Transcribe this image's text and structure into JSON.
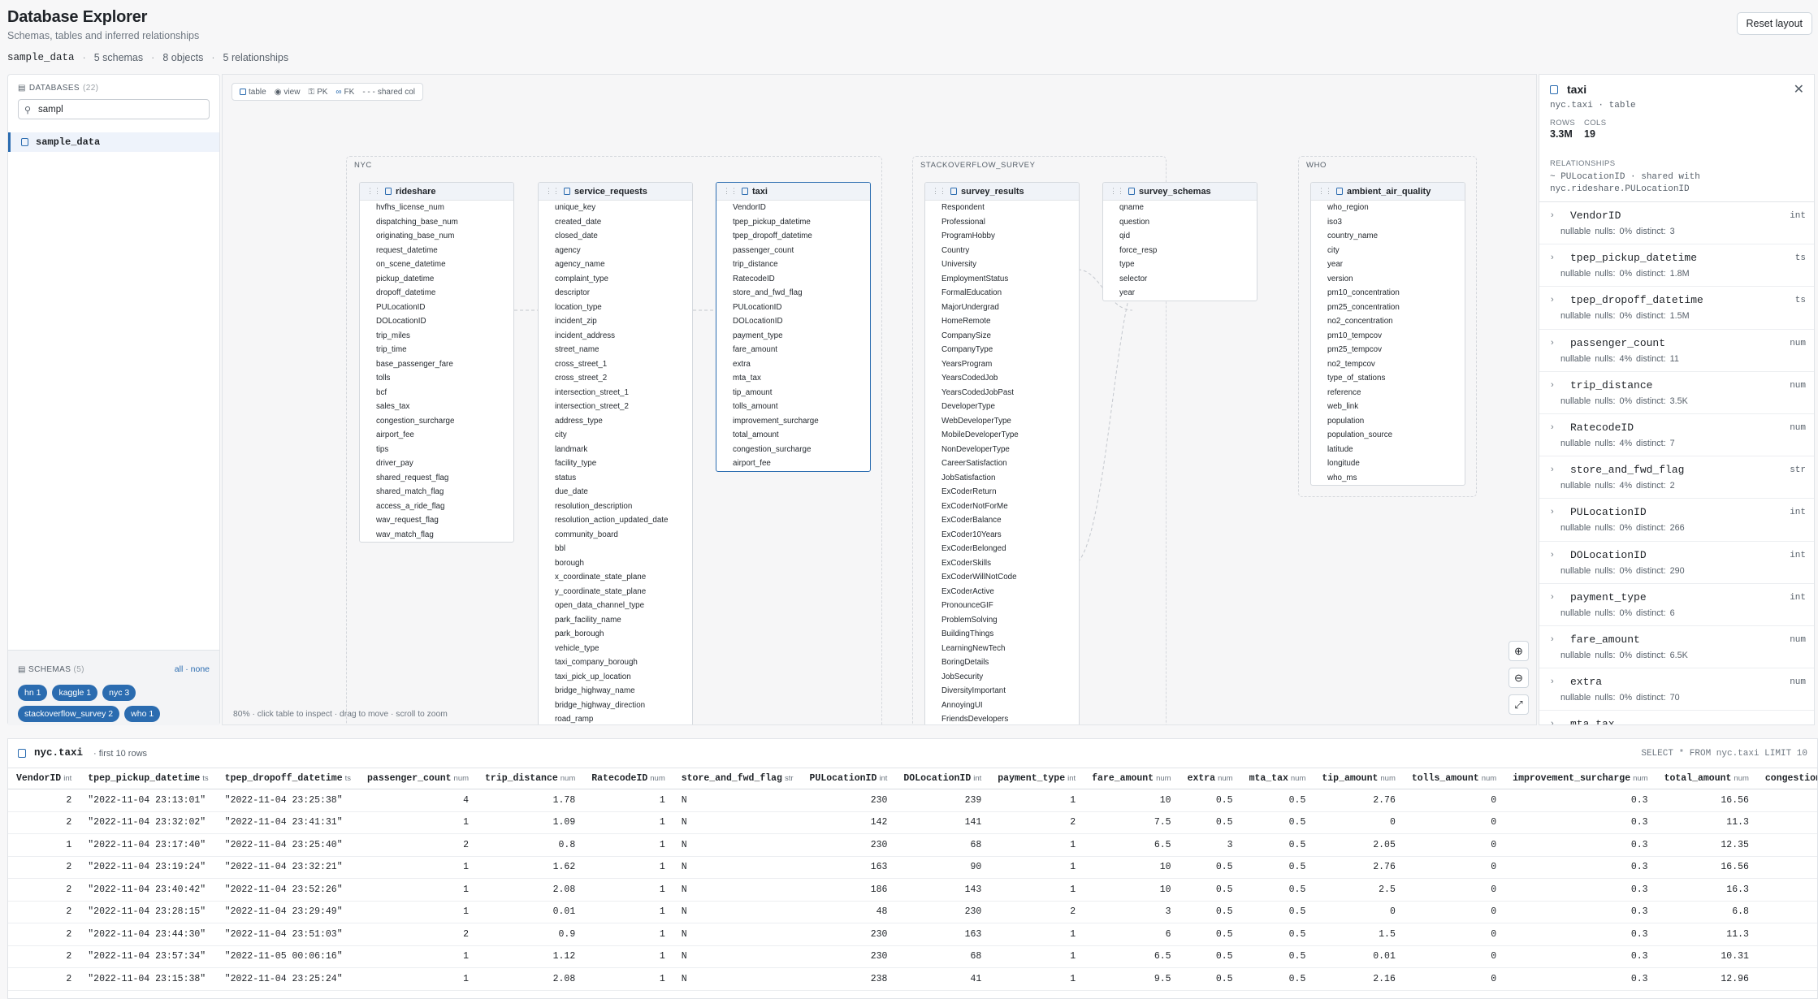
{
  "header": {
    "title": "Database Explorer",
    "subtitle": "Schemas, tables and inferred relationships",
    "reset": "Reset layout"
  },
  "crumbs": {
    "db": "sample_data",
    "schemas": "5 schemas",
    "objects": "8 objects",
    "relationships": "5 relationships"
  },
  "sidebar": {
    "title": "DATABASES",
    "count": "(22)",
    "search_value": "sampl",
    "db_item": "sample_data",
    "schemas_title": "SCHEMAS",
    "schemas_count": "(5)",
    "all": "all",
    "none": "none",
    "chips": [
      "hn 1",
      "kaggle 1",
      "nyc 3",
      "stackoverflow_survey 2",
      "who 1"
    ]
  },
  "legend": {
    "table": "table",
    "view": "view",
    "pk": "PK",
    "fk": "FK",
    "shared": "shared col"
  },
  "groups": {
    "nyc": "NYC",
    "so": "STACKOVERFLOW_SURVEY",
    "who": "WHO"
  },
  "tables": {
    "rideshare": {
      "name": "rideshare",
      "cols": [
        "hvfhs_license_num",
        "dispatching_base_num",
        "originating_base_num",
        "request_datetime",
        "on_scene_datetime",
        "pickup_datetime",
        "dropoff_datetime",
        "PULocationID",
        "DOLocationID",
        "trip_miles",
        "trip_time",
        "base_passenger_fare",
        "tolls",
        "bcf",
        "sales_tax",
        "congestion_surcharge",
        "airport_fee",
        "tips",
        "driver_pay",
        "shared_request_flag",
        "shared_match_flag",
        "access_a_ride_flag",
        "wav_request_flag",
        "wav_match_flag"
      ]
    },
    "service_requests": {
      "name": "service_requests",
      "cols": [
        "unique_key",
        "created_date",
        "closed_date",
        "agency",
        "agency_name",
        "complaint_type",
        "descriptor",
        "location_type",
        "incident_zip",
        "incident_address",
        "street_name",
        "cross_street_1",
        "cross_street_2",
        "intersection_street_1",
        "intersection_street_2",
        "address_type",
        "city",
        "landmark",
        "facility_type",
        "status",
        "due_date",
        "resolution_description",
        "resolution_action_updated_date",
        "community_board",
        "bbl",
        "borough",
        "x_coordinate_state_plane",
        "y_coordinate_state_plane",
        "open_data_channel_type",
        "park_facility_name",
        "park_borough",
        "vehicle_type",
        "taxi_company_borough",
        "taxi_pick_up_location",
        "bridge_highway_name",
        "bridge_highway_direction",
        "road_ramp"
      ]
    },
    "taxi": {
      "name": "taxi",
      "cols": [
        "VendorID",
        "tpep_pickup_datetime",
        "tpep_dropoff_datetime",
        "passenger_count",
        "trip_distance",
        "RatecodeID",
        "store_and_fwd_flag",
        "PULocationID",
        "DOLocationID",
        "payment_type",
        "fare_amount",
        "extra",
        "mta_tax",
        "tip_amount",
        "tolls_amount",
        "improvement_surcharge",
        "total_amount",
        "congestion_surcharge",
        "airport_fee"
      ]
    },
    "survey_results": {
      "name": "survey_results",
      "cols": [
        "Respondent",
        "Professional",
        "ProgramHobby",
        "Country",
        "University",
        "EmploymentStatus",
        "FormalEducation",
        "MajorUndergrad",
        "HomeRemote",
        "CompanySize",
        "CompanyType",
        "YearsProgram",
        "YearsCodedJob",
        "YearsCodedJobPast",
        "DeveloperType",
        "WebDeveloperType",
        "MobileDeveloperType",
        "NonDeveloperType",
        "CareerSatisfaction",
        "JobSatisfaction",
        "ExCoderReturn",
        "ExCoderNotForMe",
        "ExCoderBalance",
        "ExCoder10Years",
        "ExCoderBelonged",
        "ExCoderSkills",
        "ExCoderWillNotCode",
        "ExCoderActive",
        "PronounceGIF",
        "ProblemSolving",
        "BuildingThings",
        "LearningNewTech",
        "BoringDetails",
        "JobSecurity",
        "DiversityImportant",
        "AnnoyingUI",
        "FriendsDevelopers"
      ]
    },
    "survey_schemas": {
      "name": "survey_schemas",
      "cols": [
        "qname",
        "question",
        "qid",
        "force_resp",
        "type",
        "selector",
        "year"
      ]
    },
    "ambient_air_quality": {
      "name": "ambient_air_quality",
      "cols": [
        "who_region",
        "iso3",
        "country_name",
        "city",
        "year",
        "version",
        "pm10_concentration",
        "pm25_concentration",
        "no2_concentration",
        "pm10_tempcov",
        "pm25_tempcov",
        "no2_tempcov",
        "type_of_stations",
        "reference",
        "web_link",
        "population",
        "population_source",
        "latitude",
        "longitude",
        "who_ms"
      ]
    }
  },
  "canvas": {
    "hint": "80% · click table to inspect · drag to move · scroll to zoom",
    "zoom_pct": 80
  },
  "inspector": {
    "title": "taxi",
    "subtitle": "nyc.taxi · table",
    "rows_label": "ROWS",
    "rows": "3.3M",
    "cols_label": "COLS",
    "cols": "19",
    "rel_label": "RELATIONSHIPS",
    "rel_text": "~ PULocationID · shared with nyc.rideshare.PULocationID",
    "columns": [
      {
        "name": "VendorID",
        "type": "int",
        "nulls": "nulls: 0%",
        "distinct": "distinct: 3"
      },
      {
        "name": "tpep_pickup_datetime",
        "type": "ts",
        "nulls": "nulls: 0%",
        "distinct": "distinct: 1.8M"
      },
      {
        "name": "tpep_dropoff_datetime",
        "type": "ts",
        "nulls": "nulls: 0%",
        "distinct": "distinct: 1.5M"
      },
      {
        "name": "passenger_count",
        "type": "num",
        "nulls": "nulls: 4%",
        "distinct": "distinct: 11"
      },
      {
        "name": "trip_distance",
        "type": "num",
        "nulls": "nulls: 0%",
        "distinct": "distinct: 3.5K"
      },
      {
        "name": "RatecodeID",
        "type": "num",
        "nulls": "nulls: 4%",
        "distinct": "distinct: 7"
      },
      {
        "name": "store_and_fwd_flag",
        "type": "str",
        "nulls": "nulls: 4%",
        "distinct": "distinct: 2"
      },
      {
        "name": "PULocationID",
        "type": "int",
        "nulls": "nulls: 0%",
        "distinct": "distinct: 266"
      },
      {
        "name": "DOLocationID",
        "type": "int",
        "nulls": "nulls: 0%",
        "distinct": "distinct: 290"
      },
      {
        "name": "payment_type",
        "type": "int",
        "nulls": "nulls: 0%",
        "distinct": "distinct: 6"
      },
      {
        "name": "fare_amount",
        "type": "num",
        "nulls": "nulls: 0%",
        "distinct": "distinct: 6.5K"
      },
      {
        "name": "extra",
        "type": "num",
        "nulls": "nulls: 0%",
        "distinct": "distinct: 70"
      },
      {
        "name": "mta_tax",
        "type": "",
        "nulls": "",
        "distinct": ""
      }
    ],
    "nullable": "nullable"
  },
  "preview": {
    "title": "nyc.taxi",
    "subtitle": "· first 10 rows",
    "sql": "SELECT * FROM nyc.taxi LIMIT 10",
    "columns": [
      {
        "name": "VendorID",
        "type": "int",
        "w": 62
      },
      {
        "name": "tpep_pickup_datetime",
        "type": "ts",
        "w": 119
      },
      {
        "name": "tpep_dropoff_datetime",
        "type": "ts",
        "w": 123
      },
      {
        "name": "passenger_count",
        "type": "num",
        "w": 99
      },
      {
        "name": "trip_distance",
        "type": "num",
        "w": 88
      },
      {
        "name": "RatecodeID",
        "type": "num",
        "w": 77
      },
      {
        "name": "store_and_fwd_flag",
        "type": "str",
        "w": 112
      },
      {
        "name": "PULocationID",
        "type": "int",
        "w": 86
      },
      {
        "name": "DOLocationID",
        "type": "int",
        "w": 86
      },
      {
        "name": "payment_type",
        "type": "int",
        "w": 85
      },
      {
        "name": "fare_amount",
        "type": "num",
        "w": 79
      },
      {
        "name": "extra",
        "type": "num",
        "w": 42
      },
      {
        "name": "mta_tax",
        "type": "num",
        "w": 58
      },
      {
        "name": "tip_amount",
        "type": "num",
        "w": 75
      },
      {
        "name": "tolls_amount",
        "type": "num",
        "w": 85
      },
      {
        "name": "improvement_surcharge",
        "type": "num",
        "w": 137
      },
      {
        "name": "total_amount",
        "type": "num",
        "w": 89
      },
      {
        "name": "congestion_surcharge",
        "type": "num",
        "w": 140
      }
    ],
    "rows": [
      [
        "2",
        "\"2022-11-04 23:13:01\"",
        "\"2022-11-04 23:25:38\"",
        "4",
        "1.78",
        "1",
        "N",
        "230",
        "239",
        "1",
        "10",
        "0.5",
        "0.5",
        "2.76",
        "0",
        "0.3",
        "16.56",
        ""
      ],
      [
        "2",
        "\"2022-11-04 23:32:02\"",
        "\"2022-11-04 23:41:31\"",
        "1",
        "1.09",
        "1",
        "N",
        "142",
        "141",
        "2",
        "7.5",
        "0.5",
        "0.5",
        "0",
        "0",
        "0.3",
        "11.3",
        ""
      ],
      [
        "1",
        "\"2022-11-04 23:17:40\"",
        "\"2022-11-04 23:25:40\"",
        "2",
        "0.8",
        "1",
        "N",
        "230",
        "68",
        "1",
        "6.5",
        "3",
        "0.5",
        "2.05",
        "0",
        "0.3",
        "12.35",
        ""
      ],
      [
        "2",
        "\"2022-11-04 23:19:24\"",
        "\"2022-11-04 23:32:21\"",
        "1",
        "1.62",
        "1",
        "N",
        "163",
        "90",
        "1",
        "10",
        "0.5",
        "0.5",
        "2.76",
        "0",
        "0.3",
        "16.56",
        ""
      ],
      [
        "2",
        "\"2022-11-04 23:40:42\"",
        "\"2022-11-04 23:52:26\"",
        "1",
        "2.08",
        "1",
        "N",
        "186",
        "143",
        "1",
        "10",
        "0.5",
        "0.5",
        "2.5",
        "0",
        "0.3",
        "16.3",
        ""
      ],
      [
        "2",
        "\"2022-11-04 23:28:15\"",
        "\"2022-11-04 23:29:49\"",
        "1",
        "0.01",
        "1",
        "N",
        "48",
        "230",
        "2",
        "3",
        "0.5",
        "0.5",
        "0",
        "0",
        "0.3",
        "6.8",
        ""
      ],
      [
        "2",
        "\"2022-11-04 23:44:30\"",
        "\"2022-11-04 23:51:03\"",
        "2",
        "0.9",
        "1",
        "N",
        "230",
        "163",
        "1",
        "6",
        "0.5",
        "0.5",
        "1.5",
        "0",
        "0.3",
        "11.3",
        ""
      ],
      [
        "2",
        "\"2022-11-04 23:57:34\"",
        "\"2022-11-05 00:06:16\"",
        "1",
        "1.12",
        "1",
        "N",
        "230",
        "68",
        "1",
        "6.5",
        "0.5",
        "0.5",
        "0.01",
        "0",
        "0.3",
        "10.31",
        ""
      ],
      [
        "2",
        "\"2022-11-04 23:15:38\"",
        "\"2022-11-04 23:25:24\"",
        "1",
        "2.08",
        "1",
        "N",
        "238",
        "41",
        "1",
        "9.5",
        "0.5",
        "0.5",
        "2.16",
        "0",
        "0.3",
        "12.96",
        ""
      ]
    ]
  }
}
